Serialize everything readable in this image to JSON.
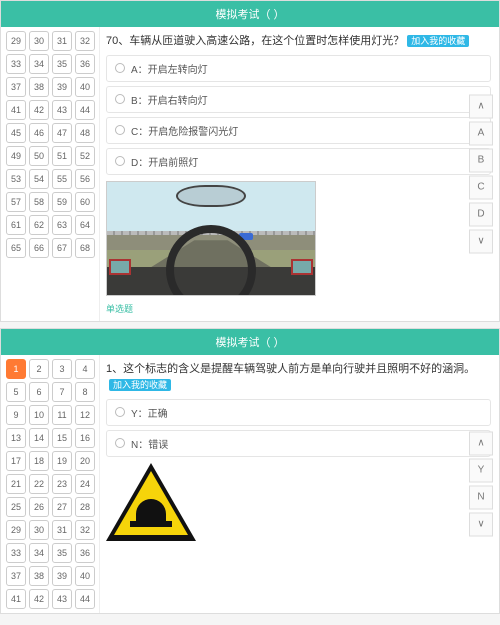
{
  "top": {
    "header": "模拟考试（ ）",
    "grid_start": 29,
    "grid_end": 68,
    "current": null,
    "question_no": "70、",
    "question_text": "车辆从匝道驶入高速公路，在这个位置时怎样使用灯光？",
    "fav_label": "加入我的收藏",
    "options": [
      "A：开启左转向灯",
      "B：开启右转向灯",
      "C：开启危险报警闪光灯",
      "D：开启前照灯"
    ],
    "tag": "单选题",
    "side": {
      "up": "∧",
      "a": "A",
      "b": "B",
      "c": "C",
      "d": "D",
      "down": "∨"
    }
  },
  "bottom": {
    "header": "模拟考试（ ）",
    "grid_start": 1,
    "grid_end": 44,
    "current": 1,
    "question_no": "1、",
    "question_text": "这个标志的含义是提醒车辆驾驶人前方是单向行驶并且照明不好的涵洞。",
    "fav_label": "加入我的收藏",
    "options": [
      "Y：正确",
      "N：错误"
    ],
    "side": {
      "up": "∧",
      "y": "Y",
      "n": "N",
      "down": "∨"
    }
  }
}
